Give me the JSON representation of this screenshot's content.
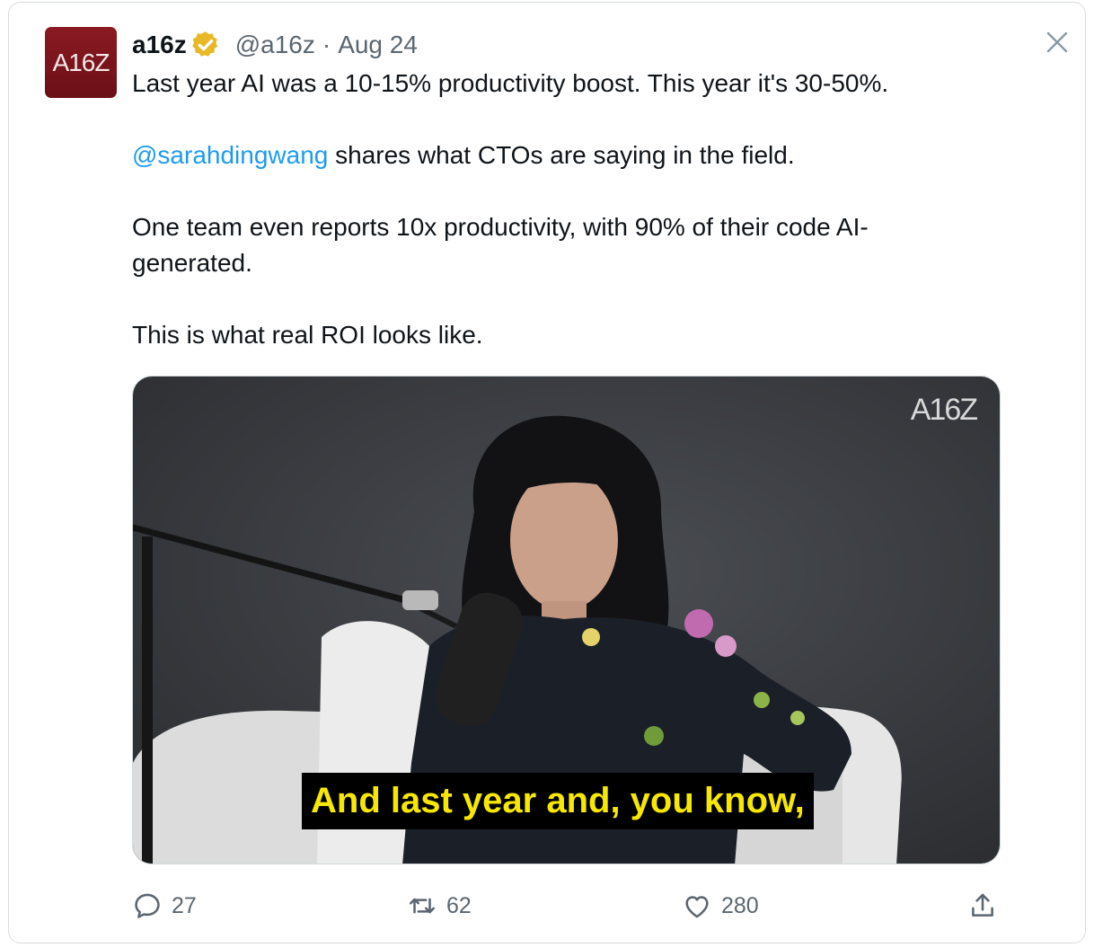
{
  "tweet": {
    "avatar_text": "A16Z",
    "display_name": "a16z",
    "handle": "@a16z",
    "separator": "·",
    "date": "Aug 24",
    "paragraphs": [
      "Last year AI was a 10-15% productivity boost. This year it's 30-50%.",
      " shares what CTOs are saying in the field.",
      "One team even reports 10x productivity, with 90% of their code AI-\ngenerated.",
      "This is what real ROI looks like."
    ],
    "mention": "@sarahdingwang"
  },
  "media": {
    "watermark": "A16Z",
    "caption": "And last year and, you know,"
  },
  "actions": {
    "reply_count": "27",
    "retweet_count": "62",
    "like_count": "280"
  },
  "icons": {
    "verified": "verified-badge-icon",
    "close": "close-icon",
    "reply": "reply-icon",
    "retweet": "retweet-icon",
    "like": "heart-icon",
    "share": "share-icon"
  },
  "colors": {
    "mention": "#1d9bf0",
    "verified_badge": "#e8b829",
    "avatar": "#7a141c",
    "caption_text": "#f6e800",
    "secondary_text": "#5b6670"
  }
}
